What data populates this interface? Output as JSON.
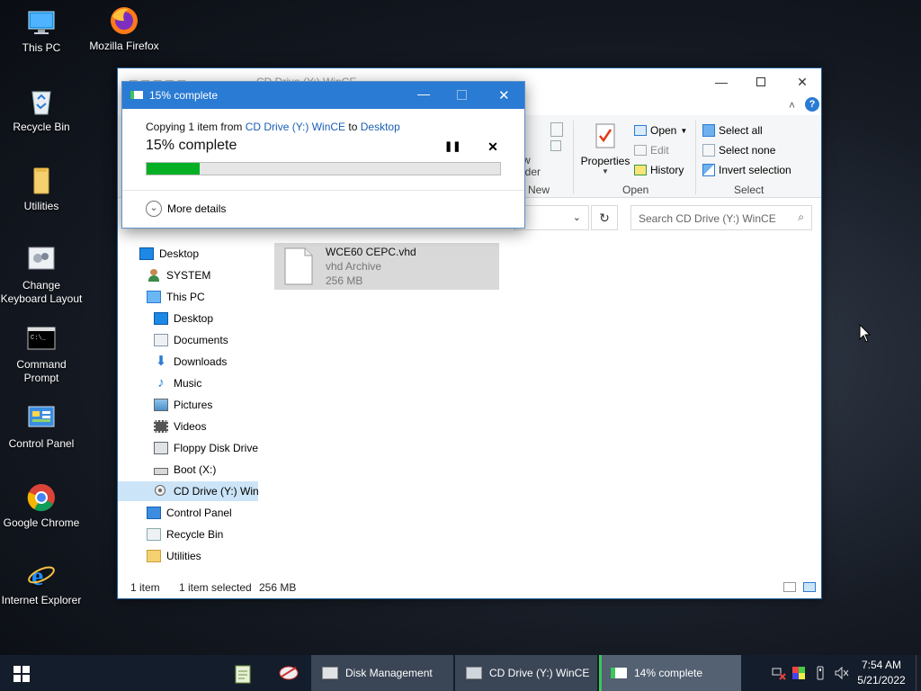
{
  "desktop": {
    "icons": [
      {
        "label": "This PC",
        "icon": "this-pc-icon"
      },
      {
        "label": "Mozilla Firefox",
        "icon": "firefox-icon"
      },
      {
        "label": "Recycle Bin",
        "icon": "recycle-bin-icon"
      },
      {
        "label": "Utilities",
        "icon": "folder-icon"
      },
      {
        "label": "Change Keyboard Layout",
        "icon": "keyboard-layout-icon"
      },
      {
        "label": "Command Prompt",
        "icon": "command-prompt-icon"
      },
      {
        "label": "Control Panel",
        "icon": "control-panel-icon"
      },
      {
        "label": "Google Chrome",
        "icon": "chrome-icon"
      },
      {
        "label": "Internet Explorer",
        "icon": "internet-explorer-icon"
      }
    ]
  },
  "explorer": {
    "title": "CD Drive (Y:) WinCE",
    "ribbon": {
      "new_group_label": "New",
      "new_folder_partial": "w\nlder",
      "properties_label": "Properties",
      "open_label": "Open",
      "edit_label": "Edit",
      "history_label": "History",
      "open_group_label": "Open",
      "select_all": "Select all",
      "select_none": "Select none",
      "invert_selection": "Invert selection",
      "select_group_label": "Select"
    },
    "search_placeholder": "Search CD Drive (Y:) WinCE",
    "nav": [
      {
        "label": "Desktop",
        "icon": "desktop-icon",
        "level": 0
      },
      {
        "label": "SYSTEM",
        "icon": "user-icon",
        "level": 0
      },
      {
        "label": "This PC",
        "icon": "this-pc-icon",
        "level": 0
      },
      {
        "label": "Desktop",
        "icon": "desktop-icon",
        "level": 1
      },
      {
        "label": "Documents",
        "icon": "documents-icon",
        "level": 1
      },
      {
        "label": "Downloads",
        "icon": "downloads-icon",
        "level": 1
      },
      {
        "label": "Music",
        "icon": "music-icon",
        "level": 1
      },
      {
        "label": "Pictures",
        "icon": "pictures-icon",
        "level": 1
      },
      {
        "label": "Videos",
        "icon": "videos-icon",
        "level": 1
      },
      {
        "label": "Floppy Disk Drive",
        "icon": "floppy-drive-icon",
        "level": 1
      },
      {
        "label": "Boot (X:)",
        "icon": "drive-icon",
        "level": 1
      },
      {
        "label": "CD Drive (Y:) WinCE",
        "icon": "cd-drive-icon",
        "level": 1,
        "selected": true
      },
      {
        "label": "Control Panel",
        "icon": "control-panel-icon",
        "level": 0
      },
      {
        "label": "Recycle Bin",
        "icon": "recycle-bin-icon",
        "level": 0
      },
      {
        "label": "Utilities",
        "icon": "folder-icon",
        "level": 0
      }
    ],
    "file": {
      "name": "WCE60 CEPC.vhd",
      "type": "vhd Archive",
      "size": "256 MB"
    },
    "status": {
      "count": "1 item",
      "selection": "1 item selected",
      "size": "256 MB"
    }
  },
  "copy_dialog": {
    "title": "15% complete",
    "copying_prefix": "Copying 1 item from ",
    "source": "CD Drive (Y:) WinCE",
    "to": " to ",
    "destination": "Desktop",
    "progress_text": "15% complete",
    "progress": 0.15,
    "more_details": "More details"
  },
  "taskbar": {
    "apps": [
      {
        "label": "Disk Management",
        "icon": "disk-management-icon"
      },
      {
        "label": "CD Drive (Y:) WinCE",
        "icon": "file-explorer-icon"
      },
      {
        "label": "14% complete",
        "icon": "copy-progress-icon"
      }
    ],
    "time": "7:54 AM",
    "date": "5/21/2022"
  },
  "colors": {
    "accent": "#2a7bd3",
    "progress": "#06b025",
    "link": "#1a5fb4",
    "taskbar": "#141d2b"
  }
}
